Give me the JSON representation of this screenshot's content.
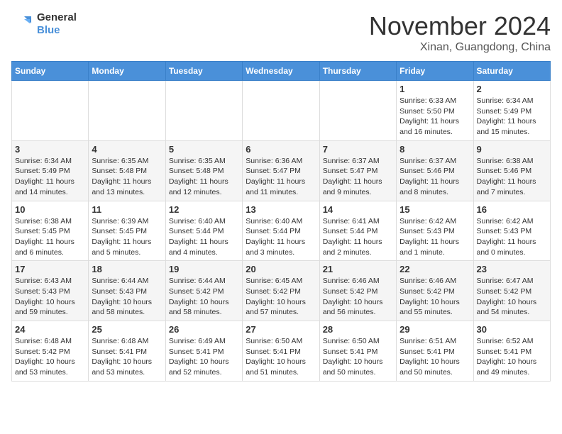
{
  "logo": {
    "line1": "General",
    "line2": "Blue"
  },
  "title": "November 2024",
  "location": "Xinan, Guangdong, China",
  "days_of_week": [
    "Sunday",
    "Monday",
    "Tuesday",
    "Wednesday",
    "Thursday",
    "Friday",
    "Saturday"
  ],
  "weeks": [
    [
      {
        "day": "",
        "info": ""
      },
      {
        "day": "",
        "info": ""
      },
      {
        "day": "",
        "info": ""
      },
      {
        "day": "",
        "info": ""
      },
      {
        "day": "",
        "info": ""
      },
      {
        "day": "1",
        "info": "Sunrise: 6:33 AM\nSunset: 5:50 PM\nDaylight: 11 hours and 16 minutes."
      },
      {
        "day": "2",
        "info": "Sunrise: 6:34 AM\nSunset: 5:49 PM\nDaylight: 11 hours and 15 minutes."
      }
    ],
    [
      {
        "day": "3",
        "info": "Sunrise: 6:34 AM\nSunset: 5:49 PM\nDaylight: 11 hours and 14 minutes."
      },
      {
        "day": "4",
        "info": "Sunrise: 6:35 AM\nSunset: 5:48 PM\nDaylight: 11 hours and 13 minutes."
      },
      {
        "day": "5",
        "info": "Sunrise: 6:35 AM\nSunset: 5:48 PM\nDaylight: 11 hours and 12 minutes."
      },
      {
        "day": "6",
        "info": "Sunrise: 6:36 AM\nSunset: 5:47 PM\nDaylight: 11 hours and 11 minutes."
      },
      {
        "day": "7",
        "info": "Sunrise: 6:37 AM\nSunset: 5:47 PM\nDaylight: 11 hours and 9 minutes."
      },
      {
        "day": "8",
        "info": "Sunrise: 6:37 AM\nSunset: 5:46 PM\nDaylight: 11 hours and 8 minutes."
      },
      {
        "day": "9",
        "info": "Sunrise: 6:38 AM\nSunset: 5:46 PM\nDaylight: 11 hours and 7 minutes."
      }
    ],
    [
      {
        "day": "10",
        "info": "Sunrise: 6:38 AM\nSunset: 5:45 PM\nDaylight: 11 hours and 6 minutes."
      },
      {
        "day": "11",
        "info": "Sunrise: 6:39 AM\nSunset: 5:45 PM\nDaylight: 11 hours and 5 minutes."
      },
      {
        "day": "12",
        "info": "Sunrise: 6:40 AM\nSunset: 5:44 PM\nDaylight: 11 hours and 4 minutes."
      },
      {
        "day": "13",
        "info": "Sunrise: 6:40 AM\nSunset: 5:44 PM\nDaylight: 11 hours and 3 minutes."
      },
      {
        "day": "14",
        "info": "Sunrise: 6:41 AM\nSunset: 5:44 PM\nDaylight: 11 hours and 2 minutes."
      },
      {
        "day": "15",
        "info": "Sunrise: 6:42 AM\nSunset: 5:43 PM\nDaylight: 11 hours and 1 minute."
      },
      {
        "day": "16",
        "info": "Sunrise: 6:42 AM\nSunset: 5:43 PM\nDaylight: 11 hours and 0 minutes."
      }
    ],
    [
      {
        "day": "17",
        "info": "Sunrise: 6:43 AM\nSunset: 5:43 PM\nDaylight: 10 hours and 59 minutes."
      },
      {
        "day": "18",
        "info": "Sunrise: 6:44 AM\nSunset: 5:43 PM\nDaylight: 10 hours and 58 minutes."
      },
      {
        "day": "19",
        "info": "Sunrise: 6:44 AM\nSunset: 5:42 PM\nDaylight: 10 hours and 58 minutes."
      },
      {
        "day": "20",
        "info": "Sunrise: 6:45 AM\nSunset: 5:42 PM\nDaylight: 10 hours and 57 minutes."
      },
      {
        "day": "21",
        "info": "Sunrise: 6:46 AM\nSunset: 5:42 PM\nDaylight: 10 hours and 56 minutes."
      },
      {
        "day": "22",
        "info": "Sunrise: 6:46 AM\nSunset: 5:42 PM\nDaylight: 10 hours and 55 minutes."
      },
      {
        "day": "23",
        "info": "Sunrise: 6:47 AM\nSunset: 5:42 PM\nDaylight: 10 hours and 54 minutes."
      }
    ],
    [
      {
        "day": "24",
        "info": "Sunrise: 6:48 AM\nSunset: 5:42 PM\nDaylight: 10 hours and 53 minutes."
      },
      {
        "day": "25",
        "info": "Sunrise: 6:48 AM\nSunset: 5:41 PM\nDaylight: 10 hours and 53 minutes."
      },
      {
        "day": "26",
        "info": "Sunrise: 6:49 AM\nSunset: 5:41 PM\nDaylight: 10 hours and 52 minutes."
      },
      {
        "day": "27",
        "info": "Sunrise: 6:50 AM\nSunset: 5:41 PM\nDaylight: 10 hours and 51 minutes."
      },
      {
        "day": "28",
        "info": "Sunrise: 6:50 AM\nSunset: 5:41 PM\nDaylight: 10 hours and 50 minutes."
      },
      {
        "day": "29",
        "info": "Sunrise: 6:51 AM\nSunset: 5:41 PM\nDaylight: 10 hours and 50 minutes."
      },
      {
        "day": "30",
        "info": "Sunrise: 6:52 AM\nSunset: 5:41 PM\nDaylight: 10 hours and 49 minutes."
      }
    ]
  ]
}
